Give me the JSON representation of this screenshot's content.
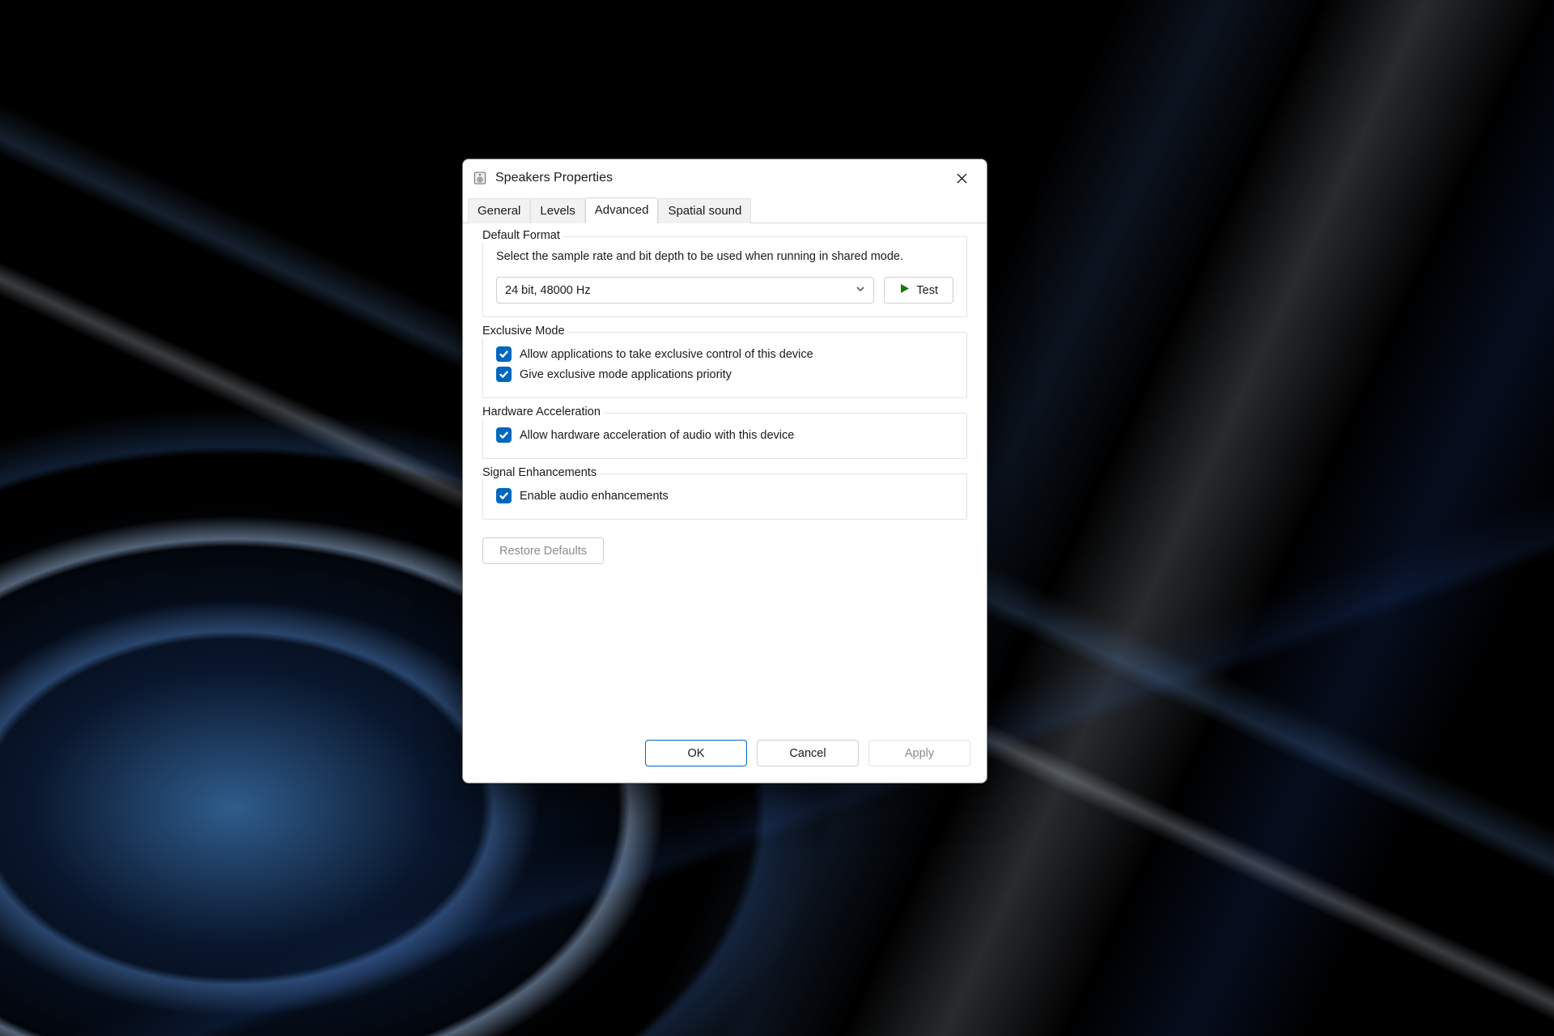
{
  "window": {
    "title": "Speakers Properties"
  },
  "tabs": {
    "general": "General",
    "levels": "Levels",
    "advanced": "Advanced",
    "spatial": "Spatial sound"
  },
  "defaultFormat": {
    "label": "Default Format",
    "desc": "Select the sample rate and bit depth to be used when running in shared mode.",
    "value": "24 bit, 48000 Hz",
    "test": "Test"
  },
  "exclusive": {
    "label": "Exclusive Mode",
    "opt1": "Allow applications to take exclusive control of this device",
    "opt2": "Give exclusive mode applications priority"
  },
  "hw": {
    "label": "Hardware Acceleration",
    "opt1": "Allow hardware acceleration of audio with this device"
  },
  "signal": {
    "label": "Signal Enhancements",
    "opt1": "Enable audio enhancements"
  },
  "restore": "Restore Defaults",
  "footer": {
    "ok": "OK",
    "cancel": "Cancel",
    "apply": "Apply"
  }
}
